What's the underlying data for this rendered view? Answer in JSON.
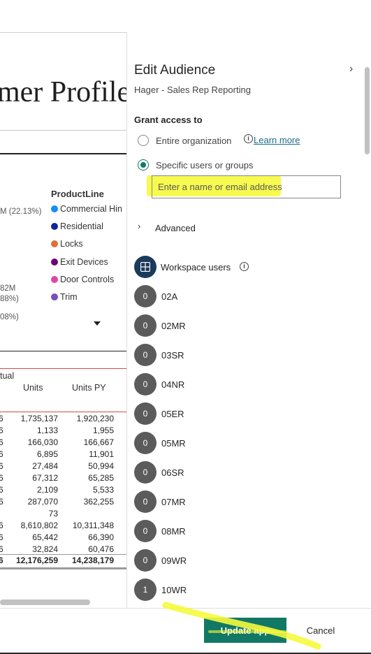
{
  "report": {
    "title": "mer Profile",
    "legend_title": "ProductLine",
    "legend": [
      {
        "label": "Commercial Hin",
        "color": "#118dff"
      },
      {
        "label": "Residential",
        "color": "#12239e"
      },
      {
        "label": "Locks",
        "color": "#e66c37"
      },
      {
        "label": "Exit Devices",
        "color": "#6b007b"
      },
      {
        "label": "Door Controls",
        "color": "#e044a7"
      },
      {
        "label": "Trim",
        "color": "#744ec2"
      }
    ],
    "pie_labels": [
      "M (22.13%)",
      "82M",
      "88%)",
      "08%)"
    ],
    "table": {
      "group_header": "tual",
      "col_units": "Units",
      "col_units_py": "Units PY",
      "rows": [
        {
          "c0": "6",
          "units": "1,735,137",
          "units_py": "1,920,230"
        },
        {
          "c0": "6",
          "units": "1,133",
          "units_py": "1,955"
        },
        {
          "c0": "6",
          "units": "166,030",
          "units_py": "166,667"
        },
        {
          "c0": "6",
          "units": "6,895",
          "units_py": "11,901"
        },
        {
          "c0": "6",
          "units": "27,484",
          "units_py": "50,994"
        },
        {
          "c0": "6",
          "units": "67,312",
          "units_py": "65,285"
        },
        {
          "c0": "6",
          "units": "2,109",
          "units_py": "5,533"
        },
        {
          "c0": "6",
          "units": "287,070",
          "units_py": "362,255"
        },
        {
          "c0": "",
          "units": "73",
          "units_py": ""
        },
        {
          "c0": "6",
          "units": "8,610,802",
          "units_py": "10,311,348"
        },
        {
          "c0": "6",
          "units": "65,442",
          "units_py": "66,390"
        },
        {
          "c0": "6",
          "units": "32,824",
          "units_py": "60,476"
        }
      ],
      "total": {
        "c0": "6",
        "units": "12,176,259",
        "units_py": "14,238,179"
      }
    }
  },
  "pane": {
    "title": "Edit Audience",
    "subtitle": "Hager - Sales Rep Reporting",
    "grant_label": "Grant access to",
    "option_entire": "Entire organization",
    "learn_more": "Learn more",
    "option_specific": "Specific users or groups",
    "input_placeholder": "Enter a name or email address",
    "advanced_label": "Advanced",
    "workspace_label": "Workspace users",
    "users": [
      {
        "badge": "0",
        "name": "02A"
      },
      {
        "badge": "0",
        "name": "02MR"
      },
      {
        "badge": "0",
        "name": "03SR"
      },
      {
        "badge": "0",
        "name": "04NR"
      },
      {
        "badge": "0",
        "name": "05ER"
      },
      {
        "badge": "0",
        "name": "05MR"
      },
      {
        "badge": "0",
        "name": "06SR"
      },
      {
        "badge": "0",
        "name": "07MR"
      },
      {
        "badge": "0",
        "name": "08MR"
      },
      {
        "badge": "0",
        "name": "09WR"
      },
      {
        "badge": "1",
        "name": "10WR"
      }
    ]
  },
  "footer": {
    "update_label": "Update app",
    "cancel_label": "Cancel"
  },
  "colors": {
    "accent": "#117865",
    "highlight": "#f6fa3c",
    "avatar": "#5b5b5b",
    "workspace_avatar": "#1b3a5c"
  }
}
